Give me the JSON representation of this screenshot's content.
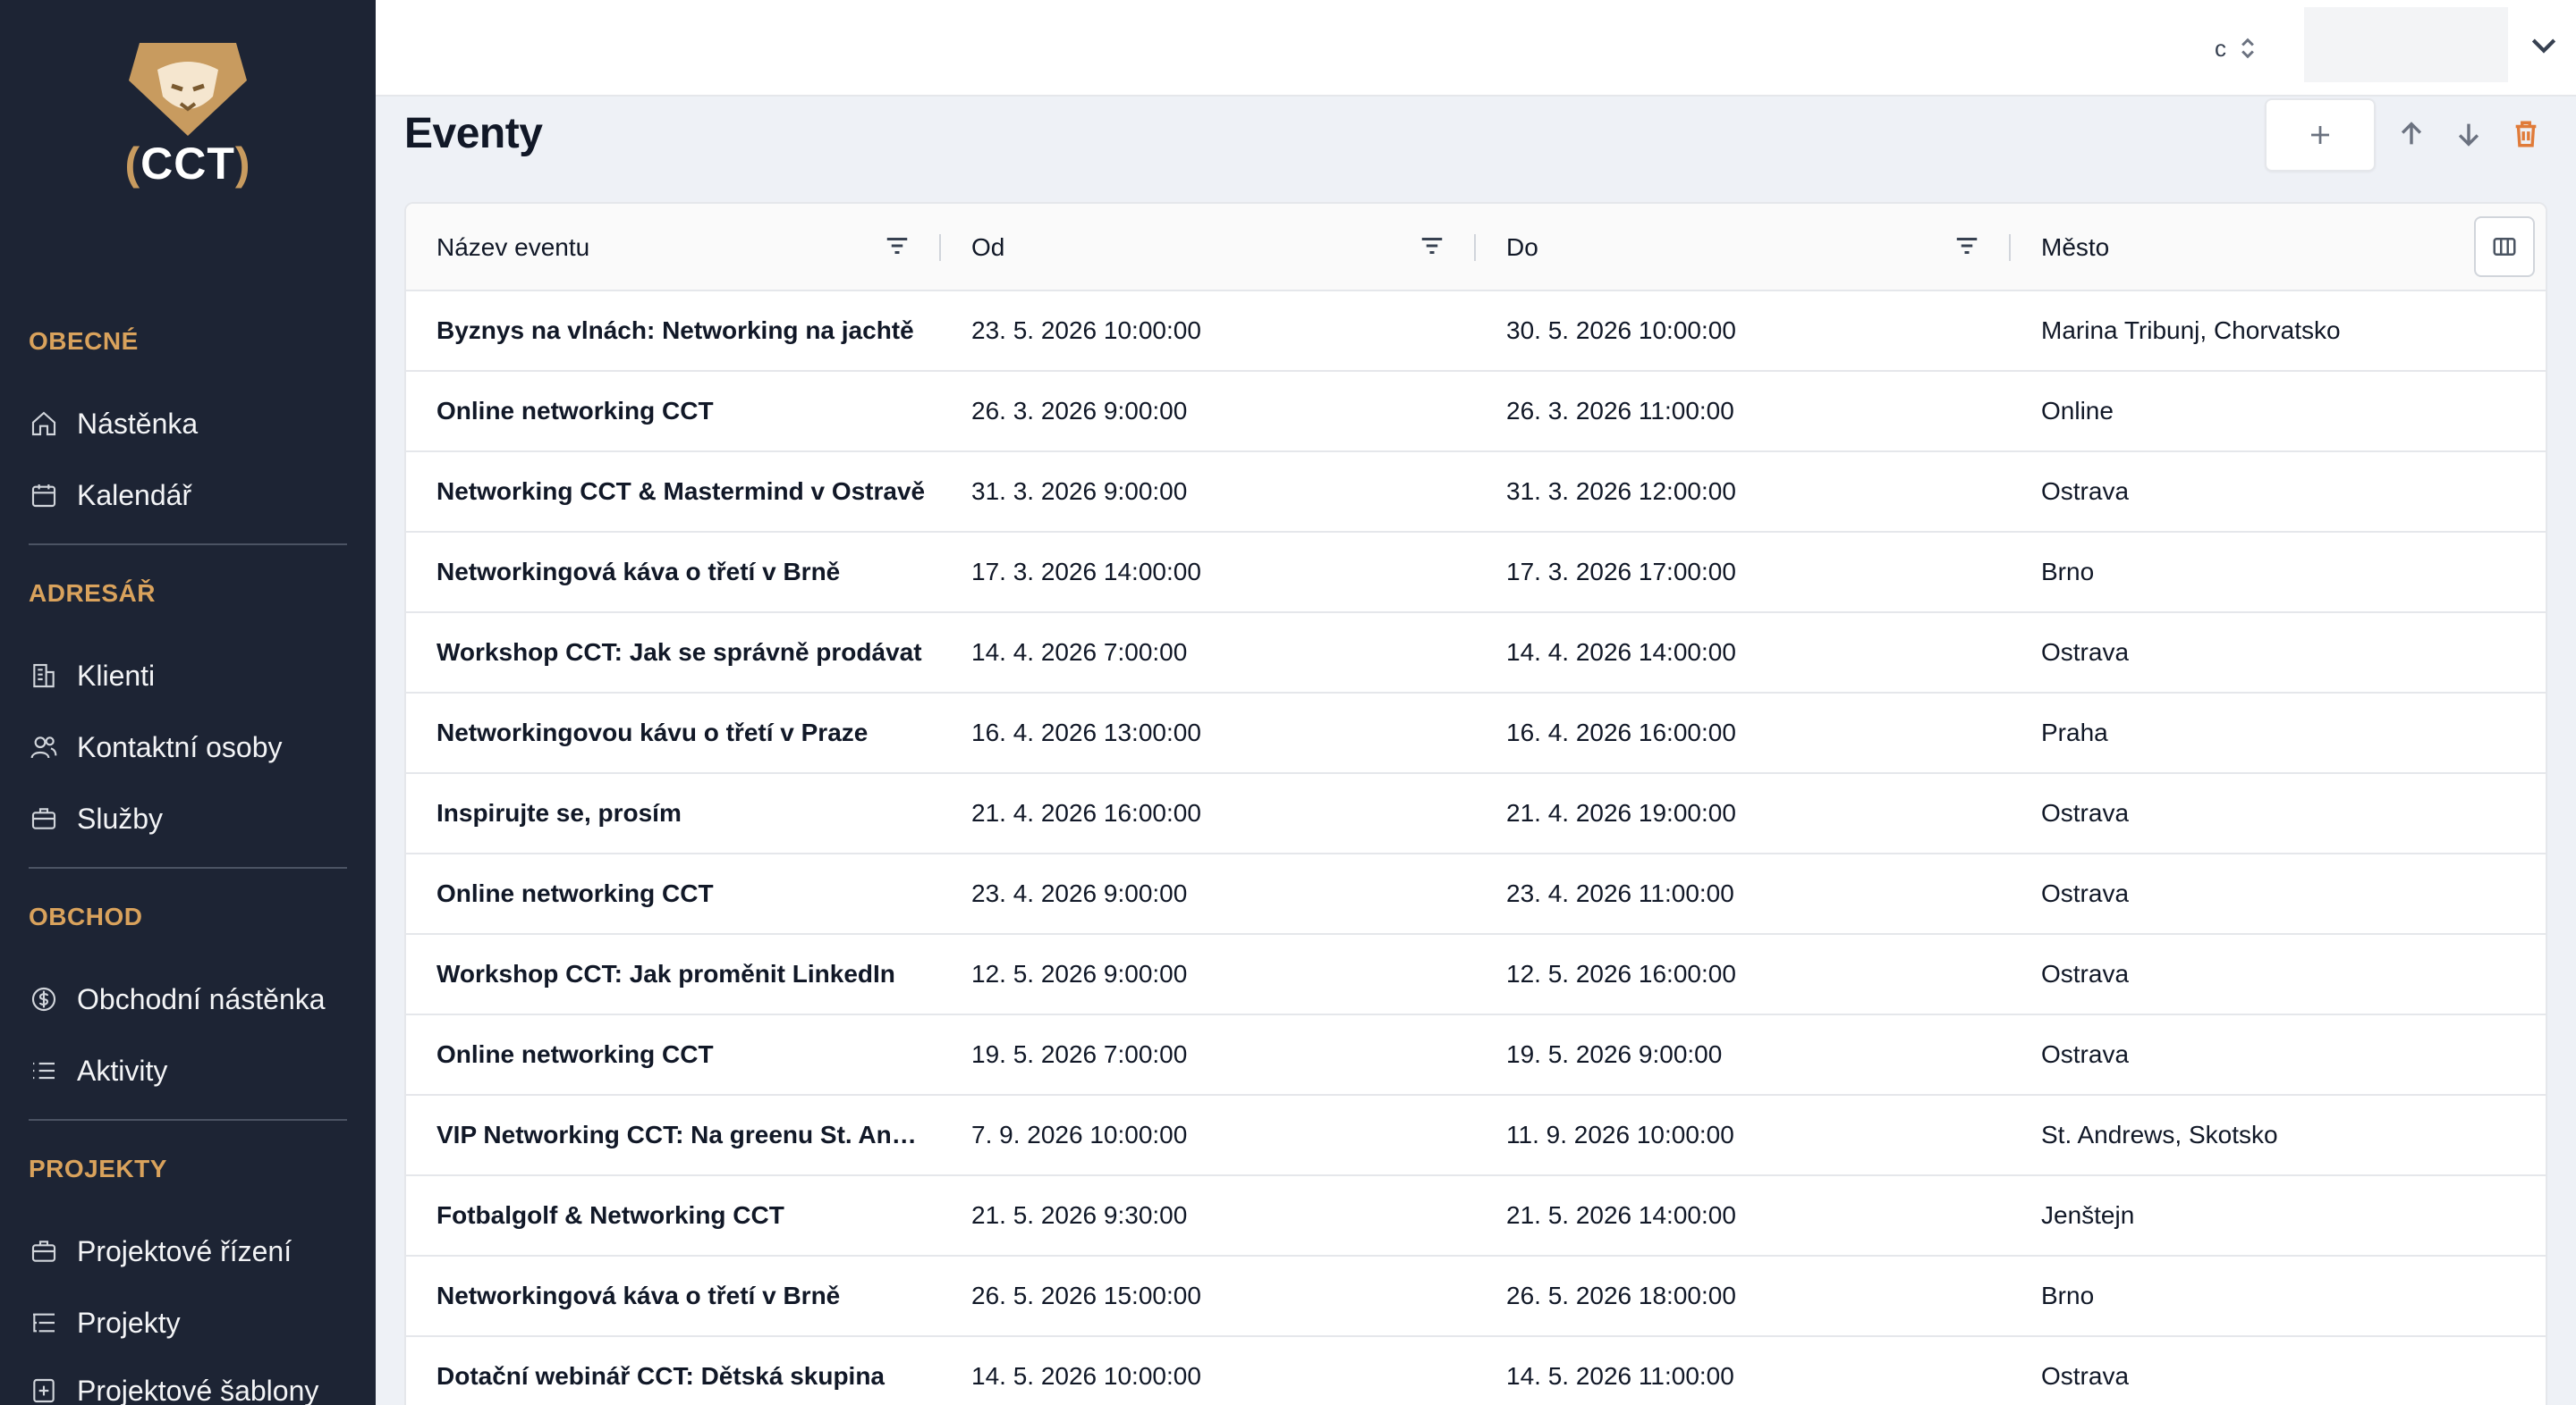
{
  "brand": {
    "logo_text": "CCT"
  },
  "sidebar": {
    "sections": [
      {
        "title": "OBECNÉ",
        "items": [
          {
            "label": "Nástěnka",
            "icon": "home-icon"
          },
          {
            "label": "Kalendář",
            "icon": "calendar-icon"
          }
        ]
      },
      {
        "title": "ADRESÁŘ",
        "items": [
          {
            "label": "Klienti",
            "icon": "building-icon"
          },
          {
            "label": "Kontaktní osoby",
            "icon": "users-icon"
          },
          {
            "label": "Služby",
            "icon": "briefcase-icon"
          }
        ]
      },
      {
        "title": "OBCHOD",
        "items": [
          {
            "label": "Obchodní nástěnka",
            "icon": "dollar-icon"
          },
          {
            "label": "Aktivity",
            "icon": "list-icon"
          }
        ]
      },
      {
        "title": "PROJEKTY",
        "items": [
          {
            "label": "Projektové řízení",
            "icon": "briefcase-icon"
          },
          {
            "label": "Projekty",
            "icon": "list-tree-icon"
          },
          {
            "label": "Projektové šablony",
            "icon": "template-icon"
          }
        ]
      }
    ]
  },
  "topbar": {
    "selector_label": "c"
  },
  "page": {
    "title": "Eventy"
  },
  "table": {
    "columns": [
      "Název eventu",
      "Od",
      "Do",
      "Město"
    ],
    "rows": [
      {
        "name": "Byznys na vlnách: Networking na jachtě",
        "od": "23. 5. 2026 10:00:00",
        "do": "30. 5. 2026 10:00:00",
        "mesto": "Marina Tribunj, Chorvatsko"
      },
      {
        "name": "Online networking CCT",
        "od": "26. 3. 2026 9:00:00",
        "do": "26. 3. 2026 11:00:00",
        "mesto": "Online"
      },
      {
        "name": "Networking CCT & Mastermind v Ostravě",
        "od": "31. 3. 2026 9:00:00",
        "do": "31. 3. 2026 12:00:00",
        "mesto": "Ostrava"
      },
      {
        "name": "Networkingová káva o třetí v Brně",
        "od": "17. 3. 2026 14:00:00",
        "do": "17. 3. 2026 17:00:00",
        "mesto": "Brno"
      },
      {
        "name": "Workshop CCT: Jak se správně prodávat",
        "od": "14. 4. 2026 7:00:00",
        "do": "14. 4. 2026 14:00:00",
        "mesto": "Ostrava"
      },
      {
        "name": "Networkingovou kávu o třetí v Praze",
        "od": "16. 4. 2026 13:00:00",
        "do": "16. 4. 2026 16:00:00",
        "mesto": "Praha"
      },
      {
        "name": "Inspirujte se, prosím",
        "od": "21. 4. 2026 16:00:00",
        "do": "21. 4. 2026 19:00:00",
        "mesto": "Ostrava"
      },
      {
        "name": "Online networking CCT",
        "od": "23. 4. 2026 9:00:00",
        "do": "23. 4. 2026 11:00:00",
        "mesto": "Ostrava"
      },
      {
        "name": "Workshop CCT: Jak proměnit LinkedIn",
        "od": "12. 5. 2026 9:00:00",
        "do": "12. 5. 2026 16:00:00",
        "mesto": "Ostrava"
      },
      {
        "name": "Online networking CCT",
        "od": "19. 5. 2026 7:00:00",
        "do": "19. 5. 2026 9:00:00",
        "mesto": "Ostrava"
      },
      {
        "name": "VIP Networking CCT: Na greenu St. Andrews",
        "od": "7. 9. 2026 10:00:00",
        "do": "11. 9. 2026 10:00:00",
        "mesto": "St. Andrews, Skotsko"
      },
      {
        "name": "Fotbalgolf & Networking CCT",
        "od": "21. 5. 2026 9:30:00",
        "do": "21. 5. 2026 14:00:00",
        "mesto": "Jenštejn"
      },
      {
        "name": "Networkingová káva o třetí v Brně",
        "od": "26. 5. 2026 15:00:00",
        "do": "26. 5. 2026 18:00:00",
        "mesto": "Brno"
      },
      {
        "name": "Dotační webinář CCT: Dětská skupina",
        "od": "14. 5. 2026 10:00:00",
        "do": "14. 5. 2026 11:00:00",
        "mesto": "Ostrava"
      }
    ]
  },
  "colors": {
    "sidebar_bg": "#1d2434",
    "accent": "#d9a25c",
    "delete": "#e07b39"
  }
}
